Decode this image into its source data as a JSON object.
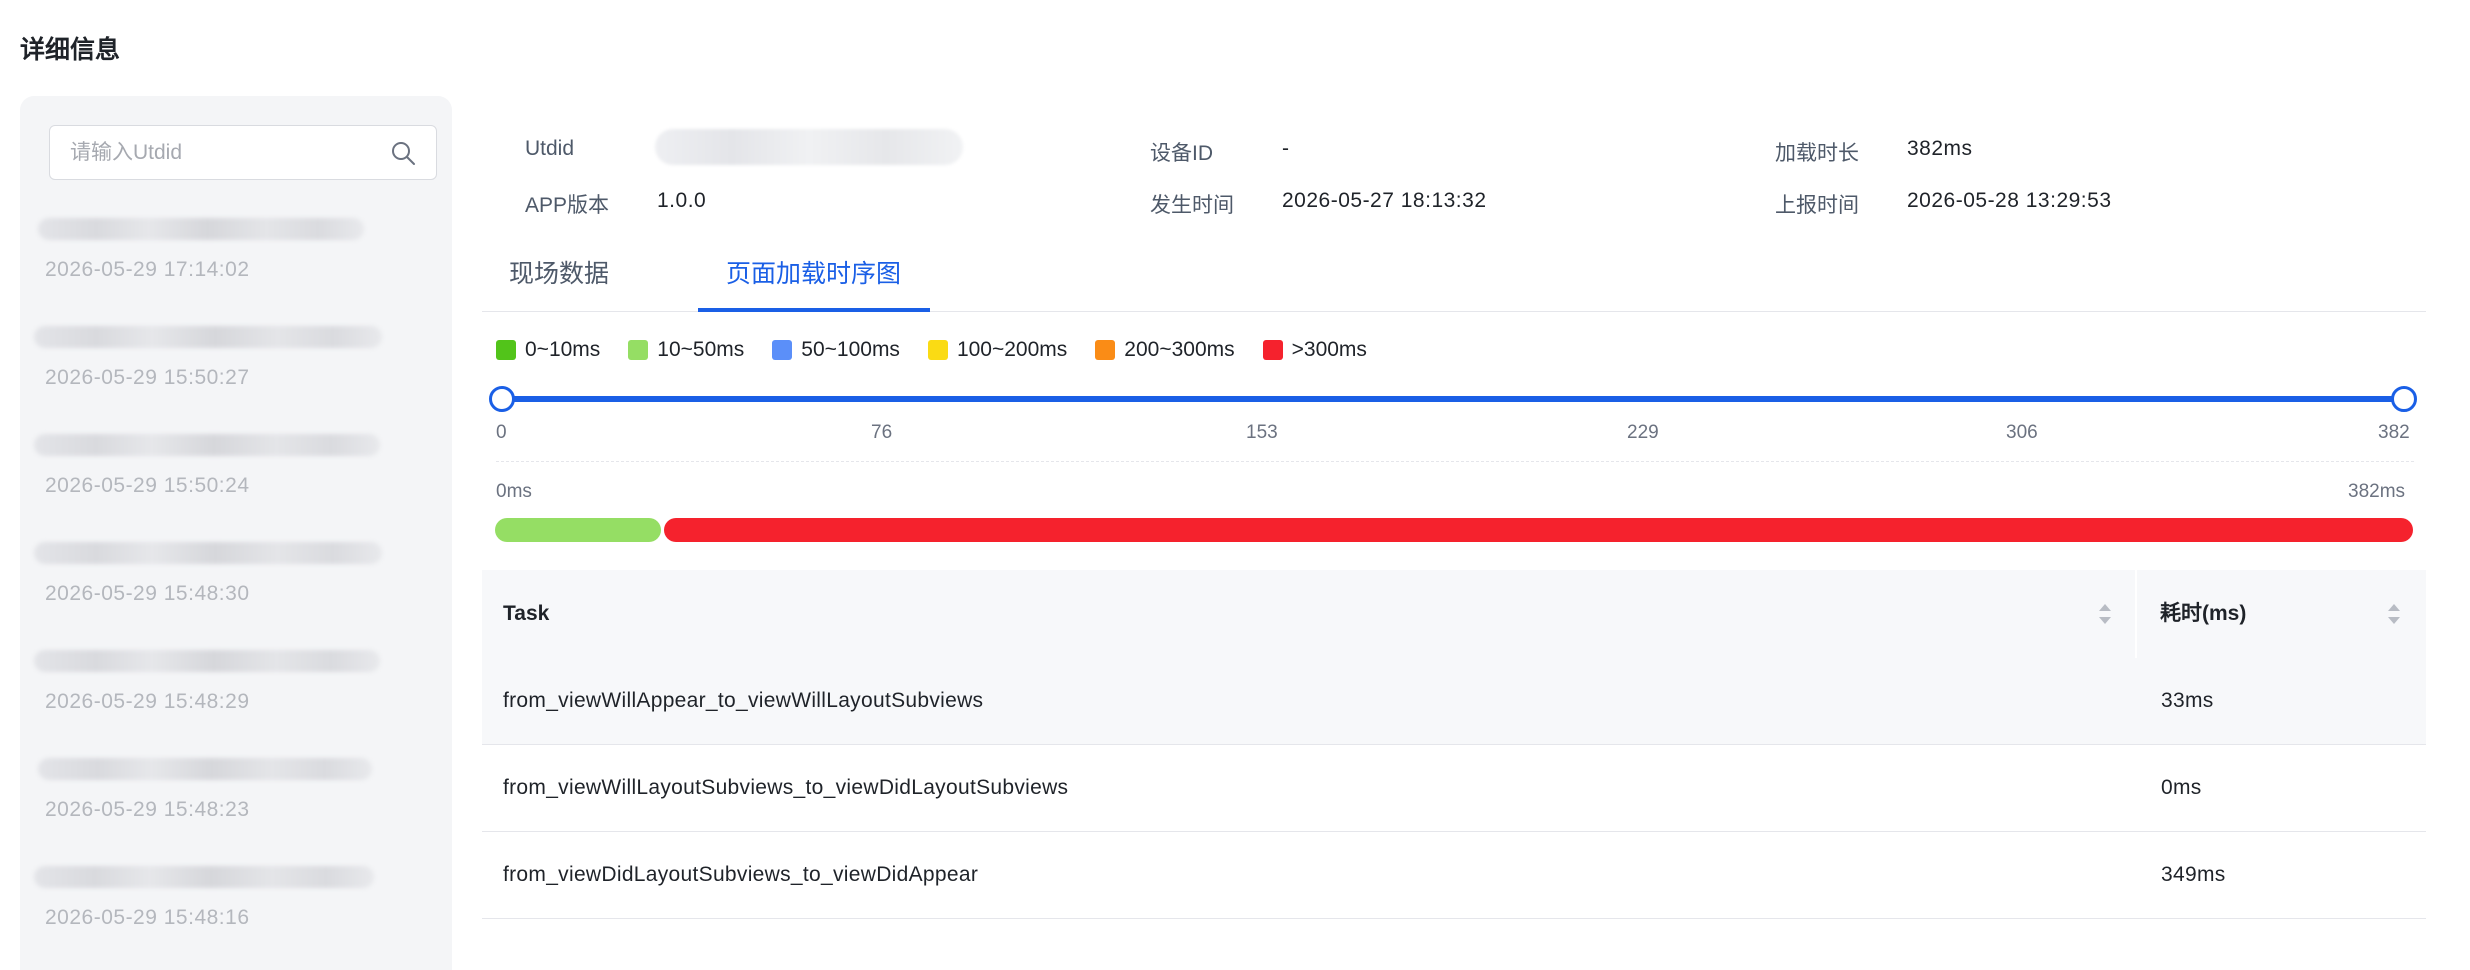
{
  "page": {
    "title": "详细信息"
  },
  "sidebar": {
    "search": {
      "placeholder": "请输入Utdid",
      "icon": "search-icon"
    },
    "records": [
      {
        "time": "2026-05-29 17:14:02"
      },
      {
        "time": "2026-05-29 15:50:27"
      },
      {
        "time": "2026-05-29 15:50:24"
      },
      {
        "time": "2026-05-29 15:48:30"
      },
      {
        "time": "2026-05-29 15:48:29"
      },
      {
        "time": "2026-05-29 15:48:23"
      },
      {
        "time": "2026-05-29 15:48:16"
      }
    ]
  },
  "info": {
    "utdid_label": "Utdid",
    "app_version_label": "APP版本",
    "app_version": "1.0.0",
    "device_id_label": "设备ID",
    "device_id": "-",
    "occur_time_label": "发生时间",
    "occur_time": "2026-05-27 18:13:32",
    "load_duration_label": "加载时长",
    "load_duration": "382ms",
    "report_time_label": "上报时间",
    "report_time": "2026-05-28 13:29:53"
  },
  "tabs": [
    {
      "label": "现场数据",
      "active": false
    },
    {
      "label": "页面加载时序图",
      "active": true
    }
  ],
  "legend": [
    {
      "label": "0~10ms",
      "color": "#52c41a"
    },
    {
      "label": "10~50ms",
      "color": "#95de64"
    },
    {
      "label": "50~100ms",
      "color": "#5b8ff9"
    },
    {
      "label": "100~200ms",
      "color": "#fadb14"
    },
    {
      "label": "200~300ms",
      "color": "#fa8c16"
    },
    {
      "label": ">300ms",
      "color": "#f5222d"
    }
  ],
  "slider": {
    "min": 0,
    "max": 382,
    "range": [
      0,
      382
    ],
    "ticks": [
      "0",
      "76",
      "153",
      "229",
      "306",
      "382"
    ],
    "accent": "#1a5fe6"
  },
  "timeline": {
    "start_label": "0ms",
    "end_label": "382ms",
    "total": 382,
    "segments": [
      {
        "start": 0,
        "duration": 33,
        "color": "#95de64"
      },
      {
        "start": 33,
        "duration": 349,
        "color": "#f5222d"
      }
    ]
  },
  "table": {
    "headers": {
      "task": "Task",
      "duration": "耗时(ms)"
    },
    "rows": [
      {
        "task": "from_viewWillAppear_to_viewWillLayoutSubviews",
        "duration": "33ms"
      },
      {
        "task": "from_viewWillLayoutSubviews_to_viewDidLayoutSubviews",
        "duration": "0ms"
      },
      {
        "task": "from_viewDidLayoutSubviews_to_viewDidAppear",
        "duration": "349ms"
      }
    ]
  }
}
